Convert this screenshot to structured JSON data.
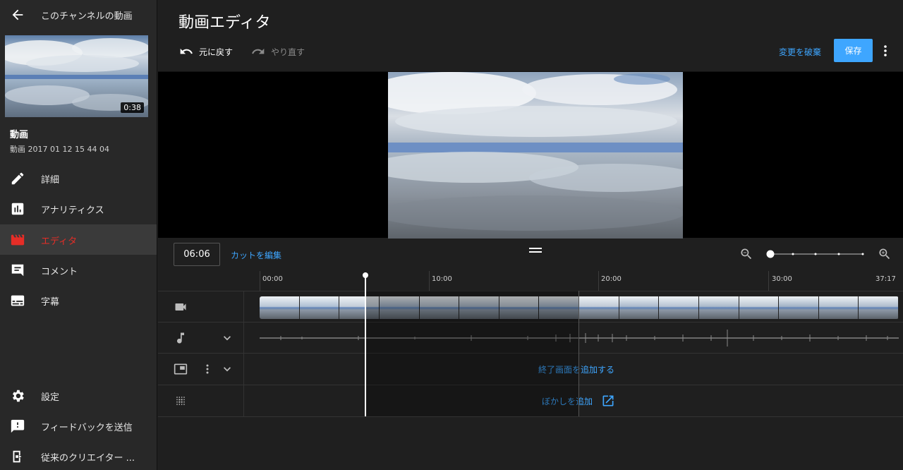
{
  "sidebar": {
    "channel_label": "このチャンネルの動画",
    "thumb_duration": "0:38",
    "video_title": "動画",
    "video_subtitle": "動画 2017 01 12 15 44 04",
    "nav": [
      {
        "label": "詳細",
        "icon": "pencil-icon"
      },
      {
        "label": "アナリティクス",
        "icon": "analytics-icon"
      },
      {
        "label": "エディタ",
        "icon": "editor-clapper-icon",
        "active": true
      },
      {
        "label": "コメント",
        "icon": "comment-icon"
      },
      {
        "label": "字幕",
        "icon": "subtitles-icon"
      }
    ],
    "bottom_nav": [
      {
        "label": "設定",
        "icon": "gear-icon"
      },
      {
        "label": "フィードバックを送信",
        "icon": "feedback-icon"
      },
      {
        "label": "従来のクリエイター ...",
        "icon": "classic-studio-icon"
      }
    ]
  },
  "header": {
    "title": "動画エディタ",
    "undo_label": "元に戻す",
    "redo_label": "やり直す",
    "discard_label": "変更を破棄",
    "save_label": "保存"
  },
  "timeline": {
    "current_time": "06:06",
    "edit_cut_label": "カットを編集",
    "ruler_labels": [
      "00:00",
      "10:00",
      "20:00",
      "30:00",
      "37:17"
    ],
    "end_screen_label": "終了画面を追加する",
    "blur_label": "ぼかしを追加",
    "zoom_level": 0
  },
  "colors": {
    "accent": "#3ea6ff",
    "active_nav": "#e52d27",
    "background": "#1f1f1f",
    "sidebar": "#282828"
  }
}
